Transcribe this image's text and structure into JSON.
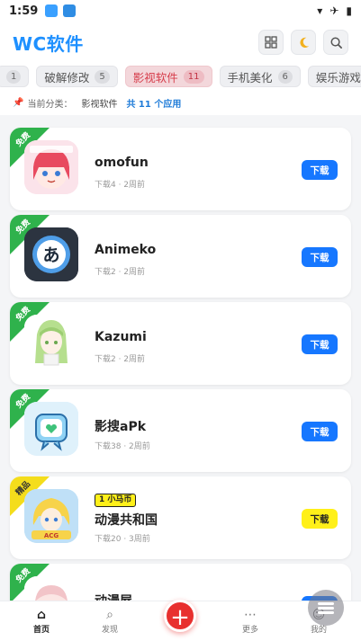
{
  "status": {
    "time": "1:59"
  },
  "header": {
    "title": "WC软件"
  },
  "categories": [
    {
      "label": "",
      "count": "1",
      "partial": true
    },
    {
      "label": "破解修改",
      "count": "5"
    },
    {
      "label": "影视软件",
      "count": "11",
      "active": true
    },
    {
      "label": "手机美化",
      "count": "6"
    },
    {
      "label": "娱乐游戏",
      "count": ""
    }
  ],
  "filter": {
    "prefix": "当前分类：",
    "current": "影视软件",
    "total": "共 11 个应用"
  },
  "apps": [
    {
      "name": "omofun",
      "meta": "下载4 · 2周前",
      "ribbon": "免费",
      "ribbon_color": "green",
      "button": "下载",
      "button_style": "blue",
      "icon": "omofun-icon"
    },
    {
      "name": "Animeko",
      "meta": "下载2 · 2周前",
      "ribbon": "免费",
      "ribbon_color": "green",
      "button": "下载",
      "button_style": "blue",
      "icon": "animeko-icon"
    },
    {
      "name": "Kazumi",
      "meta": "下载2 · 2周前",
      "ribbon": "免费",
      "ribbon_color": "green",
      "button": "下载",
      "button_style": "blue",
      "icon": "kazumi-icon"
    },
    {
      "name": "影搜aPk",
      "meta": "下载38 · 2周前",
      "ribbon": "免费",
      "ribbon_color": "green",
      "button": "下载",
      "button_style": "blue",
      "icon": "yingsou-icon"
    },
    {
      "name": "动漫共和国",
      "meta": "下载20 · 3周前",
      "ribbon": "精品",
      "ribbon_color": "yellow",
      "button": "下载",
      "button_style": "yellow",
      "tag": "1 小马币",
      "icon": "dongman-icon"
    },
    {
      "name": "动漫屋",
      "meta": "",
      "ribbon": "免费",
      "ribbon_color": "green",
      "button": "下载",
      "button_style": "blue",
      "icon": "dongmanwu-icon"
    }
  ],
  "bottom_nav": {
    "home": "首页",
    "discover": "发现",
    "more": "更多",
    "mine": "我的"
  },
  "colors": {
    "accent": "#1e90ff",
    "primary_button": "#1677ff",
    "free_ribbon": "#2fb24c",
    "premium": "#fff019",
    "fab": "#e8302f"
  }
}
